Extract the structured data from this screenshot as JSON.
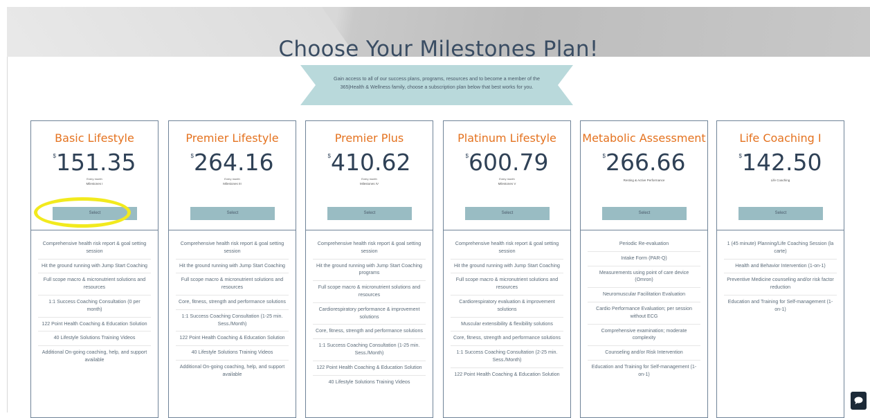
{
  "header": {
    "title": "Choose Your Milestones Plan!"
  },
  "intro": "Gain access to all of our success plans, programs, resources and to become a member of the 365|Health & Wellness family, choose a subscription plan below that best works for you.",
  "colors": {
    "accent": "#e4721f",
    "button": "#99bcc3",
    "ribbon": "#b9d9db",
    "border": "#6e8297",
    "highlight": "#f2ea1e"
  },
  "plans": [
    {
      "name": "Basic Lifestyle",
      "currency": "$",
      "price": "151.35",
      "period": "Every month",
      "subtitle": "Milestones I",
      "select_label": "Select",
      "features": [
        "Comprehensive health risk report & goal setting session",
        "Hit the ground running with Jump Start Coaching",
        "Full scope macro & micronutrient solutions and resources",
        "1:1 Success Coaching Consultation (0 per month)",
        "122 Point Health Coaching & Education Solution",
        "40 Lifestyle Solutions Training Videos",
        "Additional On-going coaching, help, and support available"
      ]
    },
    {
      "name": "Premier Lifestyle",
      "currency": "$",
      "price": "264.16",
      "period": "Every month",
      "subtitle": "Milestones III",
      "select_label": "Select",
      "features": [
        "Comprehensive health risk report & goal setting session",
        "Hit the ground running with Jump Start Coaching",
        "Full scope macro & micronutrient solutions and resources",
        "Core, fitness, strength and performance solutions",
        "1:1 Success Coaching Consultation (1-25 min. Sess./Month)",
        "122 Point Health Coaching & Education Solution",
        "40 Lifestyle Solutions Training Videos",
        "Additional On-going coaching, help, and support available"
      ]
    },
    {
      "name": "Premier Plus",
      "currency": "$",
      "price": "410.62",
      "period": "Every month",
      "subtitle": "Milestones IV",
      "select_label": "Select",
      "features": [
        "Comprehensive health risk report & goal setting session",
        "Hit the ground running with Jump Start Coaching programs",
        "Full scope macro & micronutrient solutions and resources",
        "Cardiorespiratory performance & improvement solutions",
        "Core, fitness, strength and performance solutions",
        "1:1 Success Coaching Consultation (1-25 min. Sess./Month)",
        "122 Point Health Coaching & Education Solution",
        "40 Lifestyle Solutions Training Videos"
      ]
    },
    {
      "name": "Platinum Lifestyle",
      "currency": "$",
      "price": "600.79",
      "period": "Every month",
      "subtitle": "Milestones V",
      "select_label": "Select",
      "features": [
        "Comprehensive health risk report & goal setting session",
        "Hit the ground running with Jump Start Coaching",
        "Full scope macro & micronutrient solutions and resources",
        "Cardiorespiratory evaluation & improvement solutions",
        "Muscular extensibility & flexibility solutions",
        "Core, fitness, strength and performance solutions",
        "1:1 Success Coaching Consultation (2-25 min. Sess./Month)",
        "122 Point Health Coaching & Education Solution"
      ]
    },
    {
      "name": "Metabolic Assessment",
      "currency": "$",
      "price": "266.66",
      "period": "",
      "subtitle": "Resting & Active Performance",
      "select_label": "Select",
      "features": [
        "Periodic Re-evaluation",
        "Intake Form (PAR-Q)",
        "Measurements using point of care device (Omron)",
        "Neuromuscular Facilitation Evaluation",
        "Cardio Performance Evaluation; per session without ECG",
        "Comprehensive examination; moderate complexity",
        "Counseling and/or Risk Intervention",
        "Education and Training for Self-management (1-on-1)"
      ]
    },
    {
      "name": "Life Coaching I",
      "currency": "$",
      "price": "142.50",
      "period": "",
      "subtitle": "Life Coaching",
      "select_label": "Select",
      "features": [
        "1 (45 minute) Planning/Life Coaching Session (la carte)",
        "Health and Behavior Intervention (1-on-1)",
        "Preventive Medicine counseling and/or risk factor reduction",
        "Education and Training for Self-management (1-on-1)"
      ]
    }
  ]
}
